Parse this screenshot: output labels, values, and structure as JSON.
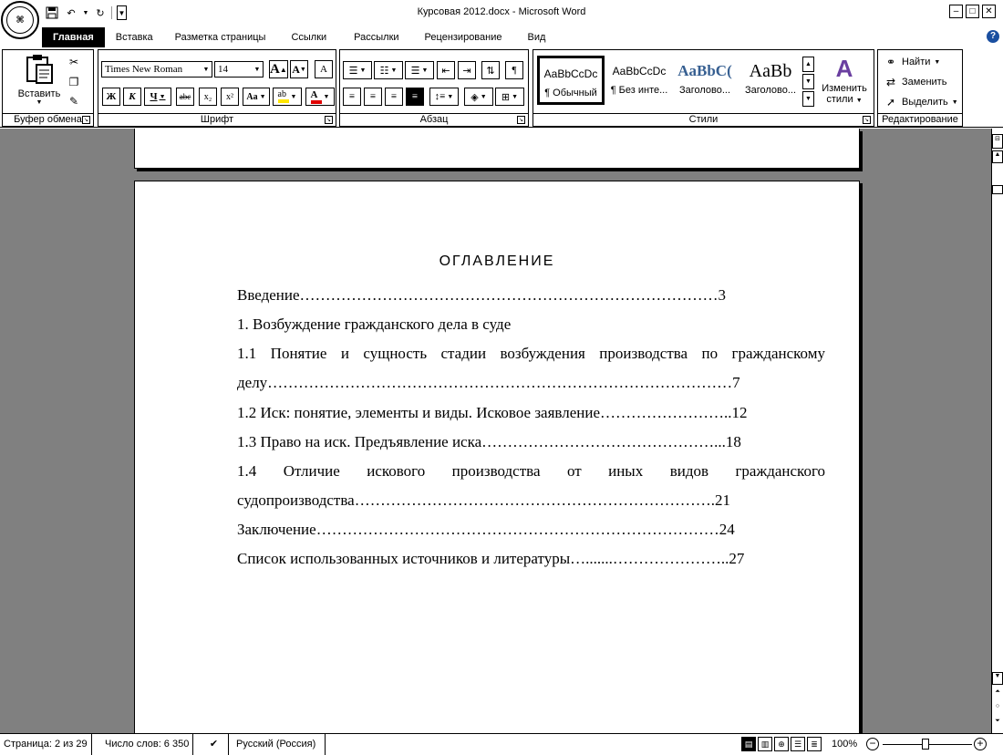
{
  "window": {
    "title": "Курсовая 2012.docx - Microsoft Word",
    "minimize": "‒",
    "maximize": "□",
    "close": "✕"
  },
  "office_button": {
    "label": "⌘"
  },
  "tabs": [
    {
      "label": "Главная",
      "active": true
    },
    {
      "label": "Вставка"
    },
    {
      "label": "Разметка страницы"
    },
    {
      "label": "Ссылки"
    },
    {
      "label": "Рассылки"
    },
    {
      "label": "Рецензирование"
    },
    {
      "label": "Вид"
    }
  ],
  "help": "?",
  "ribbon": {
    "clipboard": {
      "label": "Буфер обмена",
      "paste_label": "Вставить"
    },
    "font": {
      "label": "Шрифт",
      "font_name": "Times New Roman",
      "font_size": "14",
      "bold": "Ж",
      "italic": "К",
      "underline": "Ч",
      "strike": "abc",
      "subscript": "x₂",
      "superscript": "x²",
      "change_case": "Aa",
      "grow": "A",
      "shrink": "A",
      "clear": "A"
    },
    "paragraph": {
      "label": "Абзац"
    },
    "styles": {
      "label": "Стили",
      "items": [
        {
          "sample": "AaBbCcDc",
          "name": "¶ Обычный"
        },
        {
          "sample": "AaBbCcDc",
          "name": "¶ Без инте..."
        },
        {
          "sample": "AaBbC(",
          "name": "Заголово..."
        },
        {
          "sample": "AaBb",
          "name": "Заголово..."
        }
      ],
      "change_line1": "Изменить",
      "change_line2": "стили"
    },
    "editing": {
      "label": "Редактирование",
      "find": "Найти",
      "replace": "Заменить",
      "select": "Выделить"
    }
  },
  "document": {
    "toc_title": "ОГЛАВЛЕНИЕ",
    "lines": [
      "Введение………………………………………………………………………3",
      "1. Возбуждение гражданского дела в суде",
      "1.1 Понятие и сущность стадии возбуждения производства по гражданскому",
      "делу………………………………………………………………………………7",
      "1.2 Иск: понятие, элементы и виды. Исковое заявление……………………..12",
      "1.3 Право на иск. Предъявление иска………………………………………...18",
      "1.4 Отличие искового производства от иных видов гражданского",
      "судопроизводства…………………………………………………………….21",
      "Заключение……………………………………………………………………24",
      "Список использованных источников и литературы….......…………………..27"
    ]
  },
  "statusbar": {
    "page": "Страница: 2 из 29",
    "words": "Число слов: 6 350",
    "language": "Русский (Россия)",
    "zoom": "100%"
  }
}
